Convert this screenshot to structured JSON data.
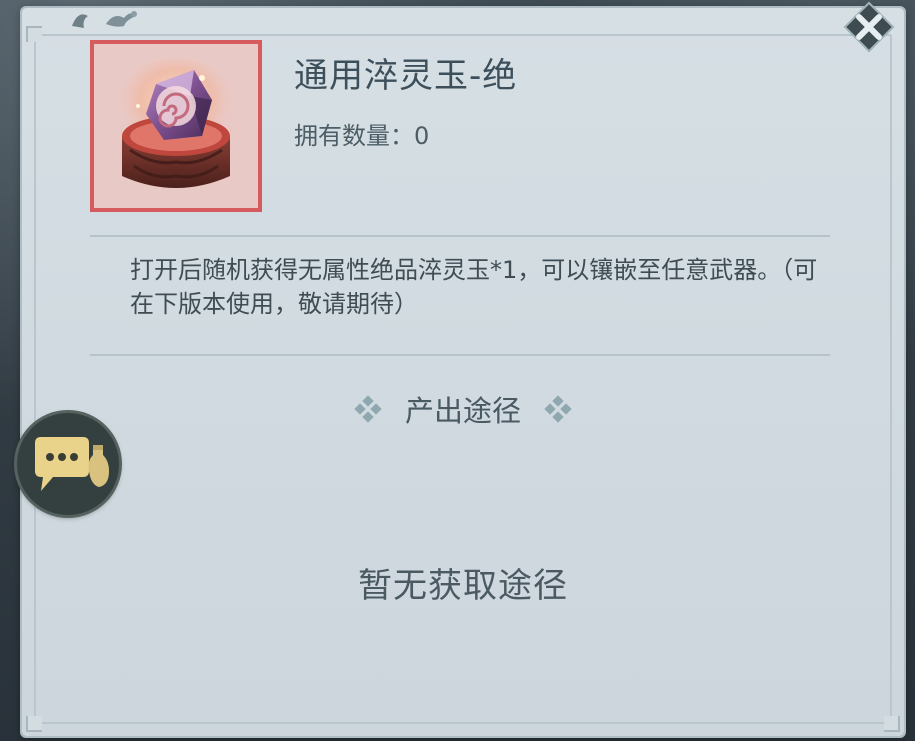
{
  "item": {
    "name": "通用淬灵玉-绝",
    "owned_label": "拥有数量：",
    "owned_count": "0",
    "description": "打开后随机获得无属性绝品淬灵玉*1，可以镶嵌至任意武器。（可在下版本使用，敬请期待）",
    "icon": "jade-box-icon",
    "frame_color": "#d65b5e"
  },
  "sources": {
    "header": "产出途径",
    "empty_text": "暂无获取途径"
  },
  "icons": {
    "close": "close-icon",
    "chat": "chat-bubble-icon",
    "ornament": "diamond-ornament-icon"
  },
  "colors": {
    "panel": "#d3dce1",
    "text_primary": "#3c4f5a",
    "accent_red": "#d65b5e",
    "ornament": "#8fa8b0"
  }
}
